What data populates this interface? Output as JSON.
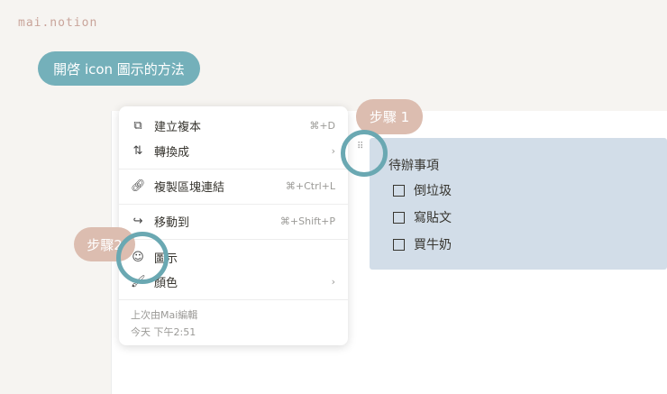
{
  "logo": "mai.notion",
  "title": "開啓 icon 圖示的方法",
  "steps": [
    "步驟 1",
    "步驟2"
  ],
  "block": {
    "heading": "待辦事項",
    "todos": [
      "倒垃圾",
      "寫貼文",
      "買牛奶"
    ]
  },
  "menu": {
    "items": [
      {
        "icon": "duplicate-icon",
        "label": "建立複本",
        "shortcut": "⌘+D"
      },
      {
        "icon": "turn-into-icon",
        "label": "轉換成",
        "shortcut": "›"
      },
      {
        "icon": "link-icon",
        "label": "複製區塊連結",
        "shortcut": "⌘+Ctrl+L"
      },
      {
        "icon": "move-to-icon",
        "label": "移動到",
        "shortcut": "⌘+Shift+P"
      },
      {
        "icon": "emoji-icon",
        "label": "圖示",
        "shortcut": ""
      },
      {
        "icon": "color-icon",
        "label": "顏色",
        "shortcut": "›"
      }
    ],
    "footer": {
      "edited_by": "上次由Mai編輯",
      "time": "今天 下午2:51"
    }
  }
}
